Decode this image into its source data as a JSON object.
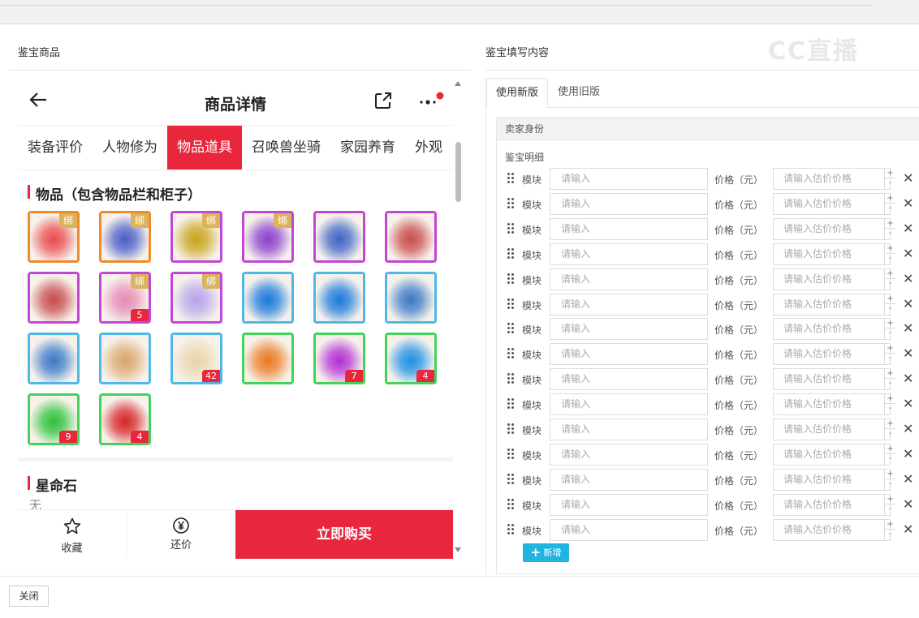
{
  "left_panel_title": "鉴宝商品",
  "right_panel_title": "鉴宝填写内容",
  "watermark": "CC直播",
  "phone": {
    "page_title": "商品详情",
    "tabs": [
      "装备评价",
      "人物修为",
      "物品道具",
      "召唤兽坐骑",
      "家园养育",
      "外观"
    ],
    "active_tab": "物品道具",
    "section1_title": "物品（包含物品栏和柜子）",
    "bind_label": "绑",
    "items": [
      {
        "name": "red-pet-hat",
        "bound": true,
        "count": "",
        "border": "#f08a2b",
        "color": "#e94b4b"
      },
      {
        "name": "blue-weapon",
        "bound": true,
        "count": "",
        "border": "#f08a2b",
        "color": "#4b5cc4"
      },
      {
        "name": "gold-armor",
        "bound": true,
        "count": "",
        "border": "#c546d6",
        "color": "#c8a21a"
      },
      {
        "name": "purple-weapon",
        "bound": true,
        "count": "",
        "border": "#c546d6",
        "color": "#8b3fc9"
      },
      {
        "name": "blue-boots",
        "bound": false,
        "count": "",
        "border": "#c546d6",
        "color": "#3f62c0"
      },
      {
        "name": "red-book",
        "bound": false,
        "count": "",
        "border": "#c546d6",
        "color": "#c84b4b"
      },
      {
        "name": "red-book-2",
        "bound": false,
        "count": "",
        "border": "#c546d6",
        "color": "#c84b4b"
      },
      {
        "name": "flower-pot",
        "bound": true,
        "count": "5",
        "border": "#c546d6",
        "color": "#e58bb3"
      },
      {
        "name": "purple-orb",
        "bound": true,
        "count": "",
        "border": "#c546d6",
        "color": "#b6a3e6"
      },
      {
        "name": "crystal-ball",
        "bound": false,
        "count": "",
        "border": "#4fb8e6",
        "color": "#1d78d6"
      },
      {
        "name": "crystal-ball-2",
        "bound": false,
        "count": "",
        "border": "#4fb8e6",
        "color": "#1d78d6"
      },
      {
        "name": "blue-book",
        "bound": false,
        "count": "",
        "border": "#4fb8e6",
        "color": "#3c79c3"
      },
      {
        "name": "blue-book-2",
        "bound": false,
        "count": "",
        "border": "#4fb8e6",
        "color": "#3c79c3"
      },
      {
        "name": "golden-pot",
        "bound": false,
        "count": "",
        "border": "#4fb8e6",
        "color": "#d9a56a"
      },
      {
        "name": "feather-dust",
        "bound": false,
        "count": "42",
        "border": "#4fb8e6",
        "color": "#e7d3a8"
      },
      {
        "name": "orange-gem",
        "bound": false,
        "count": "",
        "border": "#43d35a",
        "color": "#e8791f"
      },
      {
        "name": "purple-gem",
        "bound": false,
        "count": "7",
        "border": "#43d35a",
        "color": "#b32fd0"
      },
      {
        "name": "blue-gem",
        "bound": false,
        "count": "4",
        "border": "#43d35a",
        "color": "#1f8fe0"
      },
      {
        "name": "green-gem",
        "bound": false,
        "count": "9",
        "border": "#43d35a",
        "color": "#2fbf3a"
      },
      {
        "name": "red-gem",
        "bound": false,
        "count": "4",
        "border": "#43d35a",
        "color": "#d42424"
      }
    ],
    "section2_title": "星命石",
    "section2_value": "无",
    "favorite_label": "收藏",
    "bargain_label": "还价",
    "buy_label": "立即购买"
  },
  "form": {
    "tabs": [
      "使用新版",
      "使用旧版"
    ],
    "seller_identity": "卖家身份",
    "detail_label": "鉴宝明细",
    "row_module_label": "模块",
    "row_input_placeholder": "请输入",
    "row_price_label": "价格（元）",
    "row_price_placeholder": "请输入估价价格",
    "row_count": 15,
    "add_label": "新增"
  },
  "footer": {
    "close_label": "关闭"
  },
  "colors": {
    "accent": "#e8263c",
    "add_button": "#1fb5e0"
  }
}
